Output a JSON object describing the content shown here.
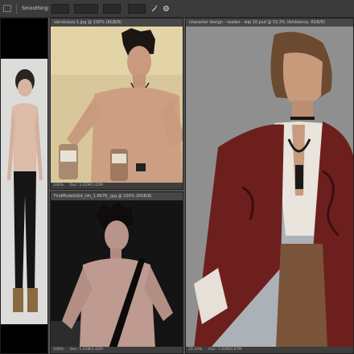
{
  "toolbar": {
    "feather_label": "Smoothing:",
    "feather_value": "",
    "mode_value": "",
    "opacity_value": "",
    "flow_label": "",
    "flow_value": ""
  },
  "docs": {
    "top_center": {
      "tab": "sid-vicious-1.jpg @ 100% (RGB/8)",
      "zoom": "100%",
      "doc_size": "Doc: 1.02M/1.02M"
    },
    "bottom_center": {
      "tab": "FindModelsSid_rdv_1.6678_.jpg @ 100% (RGB/8)",
      "zoom": "100%",
      "doc_size": "Doc: 1.02M/1.02M"
    },
    "right": {
      "tab": "character design - reader - wip 10.psd @ 33.3% (Ambience, RGB/8)",
      "zoom": "33.33%",
      "doc_size": "Doc: 1.02M/4.67M"
    },
    "left": {
      "tab": ""
    }
  },
  "colors": {
    "app_bg": "#535353",
    "panel_bg": "#2b2b2b",
    "painting_bg": "#8f8f8f",
    "coat": "#6d1f1e"
  },
  "icons": [
    "brush-icon",
    "airbrush-icon",
    "gear-icon"
  ]
}
